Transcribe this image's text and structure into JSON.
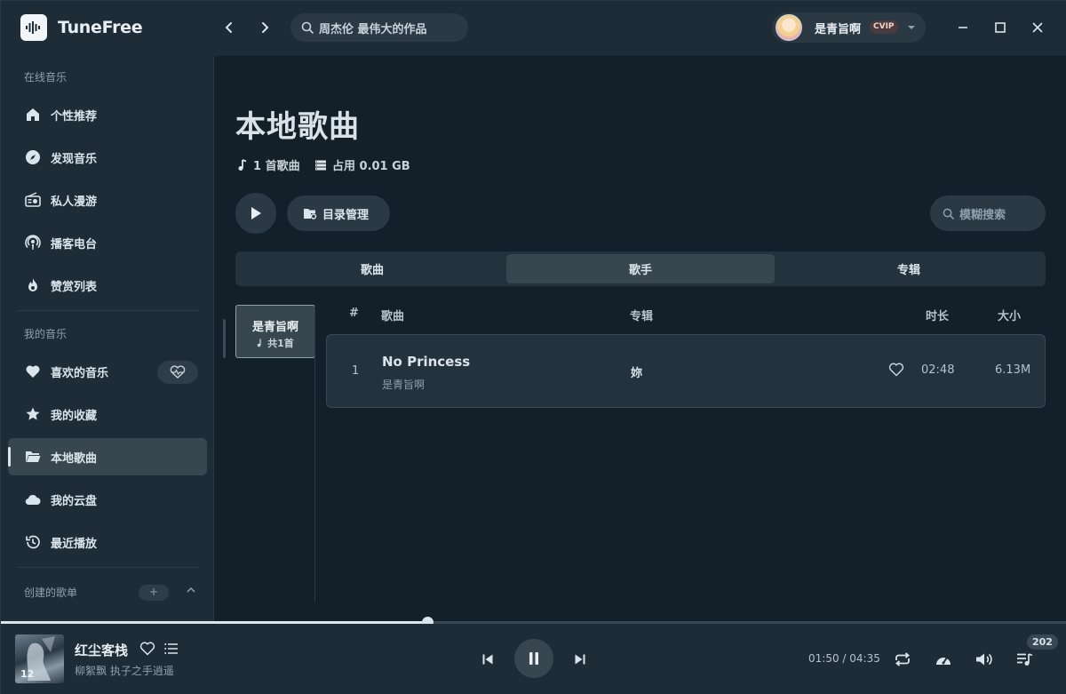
{
  "app": {
    "name": "TuneFree"
  },
  "search": {
    "value": "周杰伦 最伟大的作品"
  },
  "user": {
    "name": "是青旨啊",
    "badge": "CVIP"
  },
  "sidebar": {
    "online_section": "在线音乐",
    "online_items": [
      {
        "label": "个性推荐",
        "icon": "home-icon"
      },
      {
        "label": "发现音乐",
        "icon": "disc-icon"
      },
      {
        "label": "私人漫游",
        "icon": "radio-icon"
      },
      {
        "label": "播客电台",
        "icon": "podcast-icon"
      },
      {
        "label": "赞赏列表",
        "icon": "fire-icon"
      }
    ],
    "my_section": "我的音乐",
    "my_items": [
      {
        "label": "喜欢的音乐",
        "icon": "heart-icon"
      },
      {
        "label": "我的收藏",
        "icon": "star-icon"
      },
      {
        "label": "本地歌曲",
        "icon": "folder-icon",
        "active": true
      },
      {
        "label": "我的云盘",
        "icon": "cloud-icon"
      },
      {
        "label": "最近播放",
        "icon": "history-icon"
      }
    ],
    "created_section": "创建的歌单",
    "plus_label": "+"
  },
  "main": {
    "title": "本地歌曲",
    "song_count": "1 首歌曲",
    "storage": "占用 0.01 GB",
    "dir_button": "目录管理",
    "fuzzy_search_placeholder": "模糊搜索",
    "tabs": [
      "歌曲",
      "歌手",
      "专辑"
    ],
    "active_tab": 1,
    "artist_card": {
      "name": "是青旨啊",
      "count": "共1首"
    },
    "columns": {
      "num": "#",
      "song": "歌曲",
      "album": "专辑",
      "duration": "时长",
      "size": "大小"
    },
    "rows": [
      {
        "num": "1",
        "title": "No Princess",
        "artist": "是青旨啊",
        "album": "妳",
        "duration": "02:48",
        "size": "6.13M"
      }
    ]
  },
  "player": {
    "song": "红尘客栈",
    "artists": "柳絮飘 执子之手逍遥",
    "cover_text": "12",
    "current_time": "01:50",
    "total_time": "04:35",
    "time_sep": " / ",
    "progress": 0.4,
    "queue_count": "202"
  },
  "colors": {
    "background": "#13202a",
    "panel": "#1e2c37",
    "accent": "#dbe4ea"
  }
}
